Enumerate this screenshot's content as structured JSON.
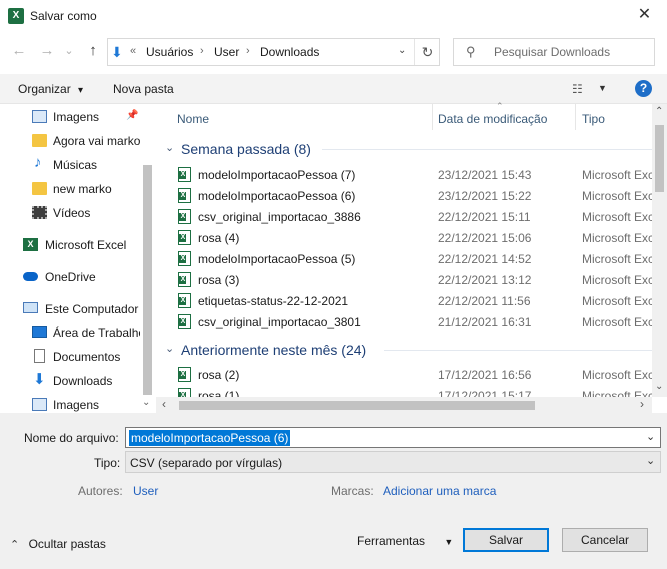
{
  "window": {
    "title": "Salvar como",
    "app_icon": "excel-icon",
    "close_glyph": "✕"
  },
  "nav": {
    "back_glyph": "←",
    "forward_glyph": "→",
    "up_glyph": "↑",
    "recent_glyph": "⌄"
  },
  "address": {
    "prefix": "«",
    "segments": [
      "Usuários",
      "User",
      "Downloads"
    ],
    "separator": "›",
    "dropdown_glyph": "⌄",
    "refresh_glyph": "↻"
  },
  "search": {
    "placeholder": "Pesquisar Downloads",
    "icon_glyph": "⚲"
  },
  "toolbar": {
    "organize_label": "Organizar",
    "organize_glyph": "▾",
    "new_folder_label": "Nova pasta",
    "view_glyph": "☷",
    "view_dd_glyph": "▼",
    "help_glyph": "?"
  },
  "sidebar": {
    "pin_glyph": "📌",
    "scroll_down_glyph": "⌄",
    "items": [
      {
        "label": "Imagens",
        "icon": "pictures-icon"
      },
      {
        "label": "Agora vai marko",
        "icon": "folder-icon"
      },
      {
        "label": "Músicas",
        "icon": "music-icon"
      },
      {
        "label": "new marko",
        "icon": "folder-icon"
      },
      {
        "label": "Vídeos",
        "icon": "videos-icon"
      },
      {
        "label": "Microsoft Excel",
        "icon": "excel-icon"
      },
      {
        "label": "OneDrive",
        "icon": "onedrive-icon"
      },
      {
        "label": "Este Computador",
        "icon": "computer-icon"
      },
      {
        "label": "Área de Trabalho",
        "icon": "desktop-icon"
      },
      {
        "label": "Documentos",
        "icon": "documents-icon"
      },
      {
        "label": "Downloads",
        "icon": "downloads-icon"
      },
      {
        "label": "Imagens",
        "icon": "pictures-icon"
      }
    ]
  },
  "columns": {
    "name": "Nome",
    "date": "Data de modificação",
    "type": "Tipo",
    "sort_glyph": "⌃"
  },
  "groups": [
    {
      "title": "Semana passada (8)",
      "chevron": "⌄",
      "files": [
        {
          "name": "modeloImportacaoPessoa (7)",
          "date": "23/12/2021 15:43",
          "type": "Microsoft Excel"
        },
        {
          "name": "modeloImportacaoPessoa (6)",
          "date": "23/12/2021 15:22",
          "type": "Microsoft Excel"
        },
        {
          "name": "csv_original_importacao_3886",
          "date": "22/12/2021 15:11",
          "type": "Microsoft Excel"
        },
        {
          "name": "rosa (4)",
          "date": "22/12/2021 15:06",
          "type": "Microsoft Excel"
        },
        {
          "name": "modeloImportacaoPessoa (5)",
          "date": "22/12/2021 14:52",
          "type": "Microsoft Excel"
        },
        {
          "name": "rosa (3)",
          "date": "22/12/2021 13:12",
          "type": "Microsoft Excel"
        },
        {
          "name": "etiquetas-status-22-12-2021",
          "date": "22/12/2021 11:56",
          "type": "Microsoft Excel"
        },
        {
          "name": "csv_original_importacao_3801",
          "date": "21/12/2021 16:31",
          "type": "Microsoft Excel"
        }
      ]
    },
    {
      "title": "Anteriormente neste mês (24)",
      "chevron": "⌄",
      "files": [
        {
          "name": "rosa (2)",
          "date": "17/12/2021 16:56",
          "type": "Microsoft Excel"
        },
        {
          "name": "rosa (1)",
          "date": "17/12/2021 15:17",
          "type": "Microsoft Excel"
        }
      ]
    }
  ],
  "scrollbars": {
    "up_glyph": "⌃",
    "down_glyph": "⌄",
    "left_glyph": "‹",
    "right_glyph": "›"
  },
  "form": {
    "filename_label": "Nome do arquivo:",
    "filename_value": "modeloImportacaoPessoa (6)",
    "filetype_label": "Tipo:",
    "filetype_value": "CSV (separado por vírgulas)",
    "dd_glyph": "⌄",
    "authors_label": "Autores:",
    "authors_value": "User",
    "tags_label": "Marcas:",
    "tags_value": "Adicionar uma marca"
  },
  "footer": {
    "hide_folders_glyph": "⌃",
    "hide_folders_label": "Ocultar pastas",
    "tools_label": "Ferramentas",
    "tools_glyph": "▼",
    "save_label": "Salvar",
    "cancel_label": "Cancelar"
  },
  "colors": {
    "accent": "#0078d7",
    "excel_green": "#1d6f42",
    "group_header": "#1e3f75",
    "link": "#1f5fbd"
  }
}
